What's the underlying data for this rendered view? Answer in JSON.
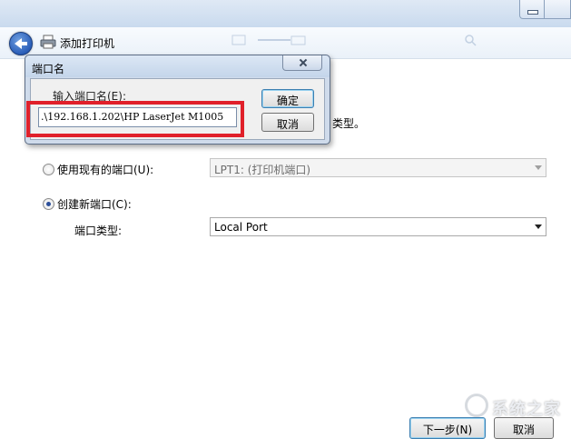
{
  "wizard": {
    "title": "添加打印机",
    "prompt_tail": "类型。",
    "use_existing_label": "使用现有的端口(U):",
    "use_existing_value": "LPT1: (打印机端口)",
    "create_new_label": "创建新端口(C):",
    "port_type_label": "端口类型:",
    "port_type_value": "Local Port",
    "next_label": "下一步(N)",
    "cancel_label": "取消"
  },
  "dialog": {
    "title": "端口名",
    "input_label": "输入端口名(E):",
    "input_value": ".\\192.168.1.202\\HP LaserJet M1005",
    "ok_label": "确定",
    "cancel_label": "取消"
  },
  "watermark": {
    "text": "系统之家"
  },
  "colors": {
    "highlight_border": "#e0202a",
    "accent": "#2a5eb8"
  }
}
